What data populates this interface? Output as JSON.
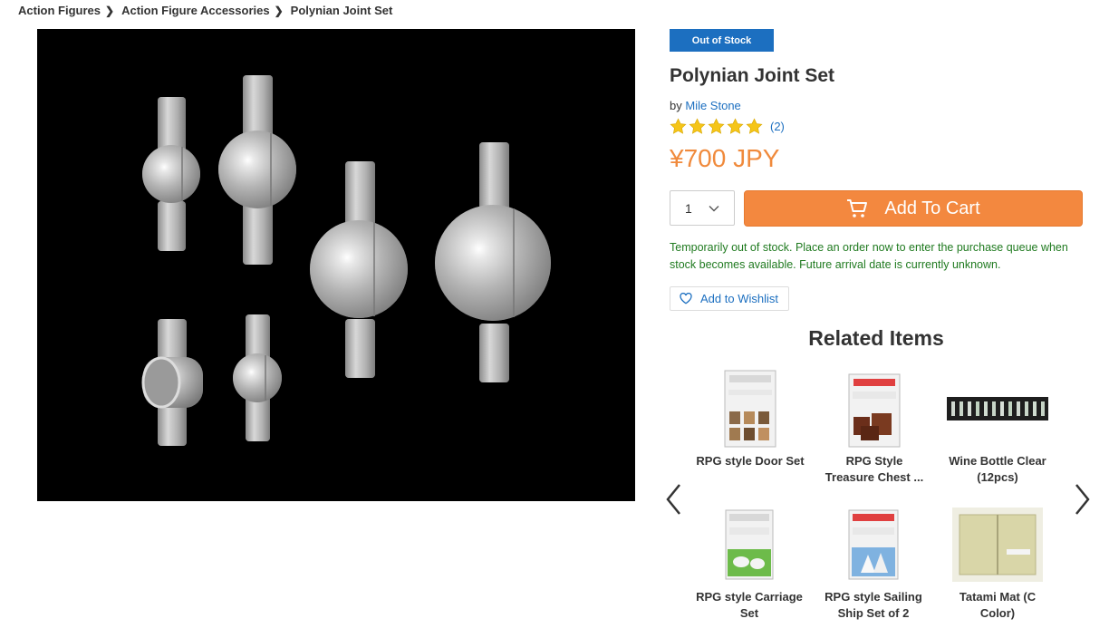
{
  "breadcrumb": {
    "items": [
      "Action Figures",
      "Action Figure Accessories",
      "Polynian Joint Set"
    ],
    "separator": "❯"
  },
  "product": {
    "stock_badge": "Out of Stock",
    "title": "Polynian Joint Set",
    "by_label": "by",
    "brand": "Mile Stone",
    "rating_stars": 5,
    "review_count": "(2)",
    "price": "¥700 JPY",
    "quantity": "1",
    "add_to_cart_label": "Add To Cart",
    "notice": "Temporarily out of stock. Place an order now to enter the purchase queue when stock becomes available. Future arrival date is currently unknown.",
    "wishlist_label": "Add to Wishlist"
  },
  "related": {
    "title": "Related Items",
    "items": [
      {
        "label": "RPG style Door Set"
      },
      {
        "label": "RPG Style Treasure Chest ..."
      },
      {
        "label": "Wine Bottle Clear (12pcs)"
      },
      {
        "label": "RPG style Carriage Set"
      },
      {
        "label": "RPG style Sailing Ship Set of 2"
      },
      {
        "label": "Tatami Mat (C Color)"
      }
    ]
  },
  "colors": {
    "accent_blue": "#1c6fc0",
    "cart_orange": "#f3883f",
    "price_orange": "#f08a3c",
    "stock_green": "#1f7a1f",
    "star_yellow": "#f5c518"
  },
  "icons": {
    "breadcrumb_separator": "chevron-right-icon",
    "rating": "star-icon",
    "quantity": "chevron-down-icon",
    "cart": "cart-icon",
    "wishlist": "heart-icon",
    "carousel_prev": "chevron-left-icon",
    "carousel_next": "chevron-right-icon"
  }
}
